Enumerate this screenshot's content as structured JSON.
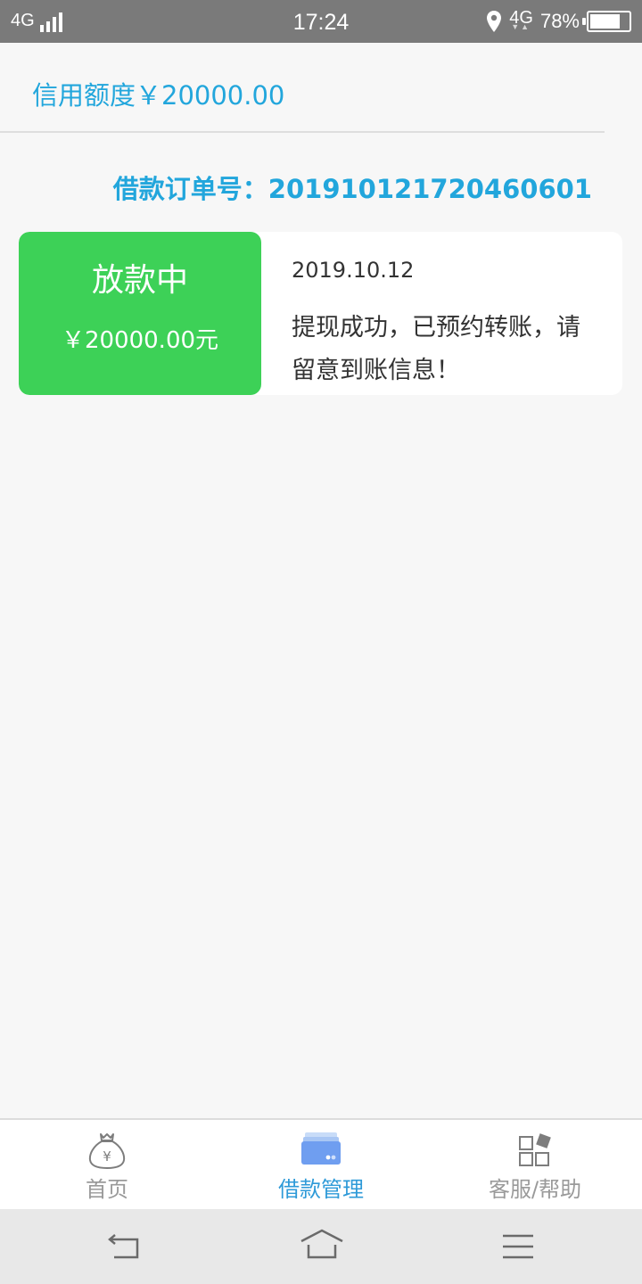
{
  "status_bar": {
    "network_left": "4G",
    "time": "17:24",
    "network_right": "4G",
    "battery_percent": "78%",
    "battery_level": 0.78
  },
  "credit": {
    "text": "信用额度￥20000.00"
  },
  "order": {
    "label_and_number": "借款订单号：201910121720460601"
  },
  "loan_card": {
    "status": "放款中",
    "amount": "￥20000.00元",
    "date": "2019.10.12",
    "message": "提现成功，已预约转账，请留意到账信息！"
  },
  "tabs": [
    {
      "label": "首页",
      "icon": "money-bag-icon",
      "active": false
    },
    {
      "label": "借款管理",
      "icon": "wallet-card-icon",
      "active": true
    },
    {
      "label": "客服/帮助",
      "icon": "grid-apps-icon",
      "active": false
    }
  ],
  "colors": {
    "accent": "#22a6dc",
    "status_green": "#3dd157",
    "tab_active": "#2e9ad8",
    "tab_inactive": "#9a9a9a"
  }
}
